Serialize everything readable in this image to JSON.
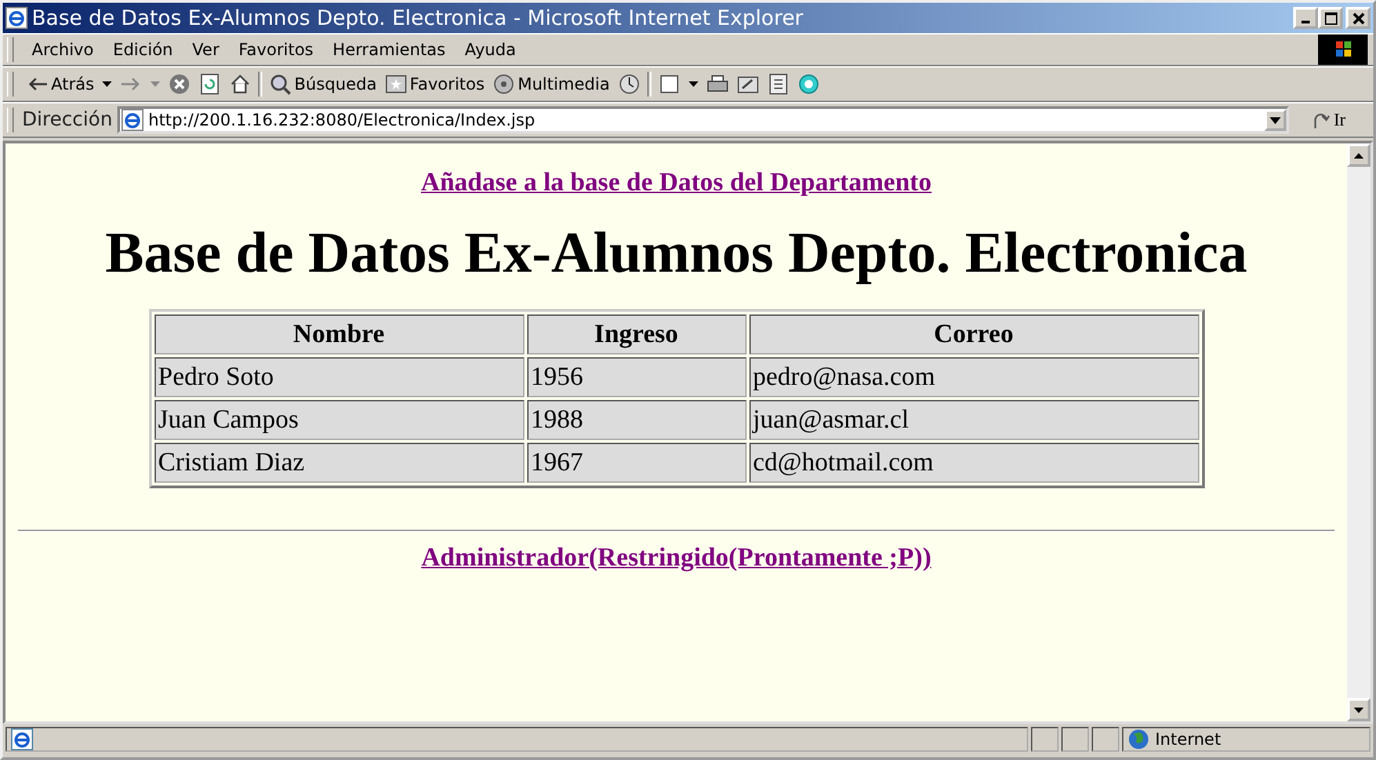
{
  "window": {
    "title": "Base de Datos Ex-Alumnos Depto. Electronica - Microsoft Internet Explorer"
  },
  "menu": [
    "Archivo",
    "Edición",
    "Ver",
    "Favoritos",
    "Herramientas",
    "Ayuda"
  ],
  "toolbar": [
    {
      "kind": "back",
      "label": "Atrás"
    },
    {
      "kind": "forward"
    },
    {
      "kind": "stop"
    },
    {
      "kind": "refresh"
    },
    {
      "kind": "home"
    },
    {
      "kind": "sep"
    },
    {
      "kind": "search",
      "label": "Búsqueda"
    },
    {
      "kind": "favorites",
      "label": "Favoritos"
    },
    {
      "kind": "media",
      "label": "Multimedia"
    },
    {
      "kind": "history"
    },
    {
      "kind": "sep"
    },
    {
      "kind": "mail"
    },
    {
      "kind": "print"
    },
    {
      "kind": "edit"
    },
    {
      "kind": "discuss"
    },
    {
      "kind": "messenger"
    }
  ],
  "address": {
    "label": "Dirección",
    "url": "http://200.1.16.232:8080/Electronica/Index.jsp",
    "go": "Ir"
  },
  "page": {
    "top_link": "Añadase a la base de Datos del Departamento",
    "heading": "Base de Datos Ex-Alumnos Depto. Electronica",
    "table": {
      "columns": [
        "Nombre",
        "Ingreso",
        "Correo"
      ],
      "rows": [
        [
          "Pedro Soto",
          "1956",
          "pedro@nasa.com"
        ],
        [
          "Juan Campos",
          "1988",
          "juan@asmar.cl"
        ],
        [
          "Cristiam Diaz",
          "1967",
          "cd@hotmail.com"
        ]
      ]
    },
    "bottom_link": "Administrador(Restringido(Prontamente ;P))"
  },
  "status_bar": {
    "zone": "Internet"
  }
}
